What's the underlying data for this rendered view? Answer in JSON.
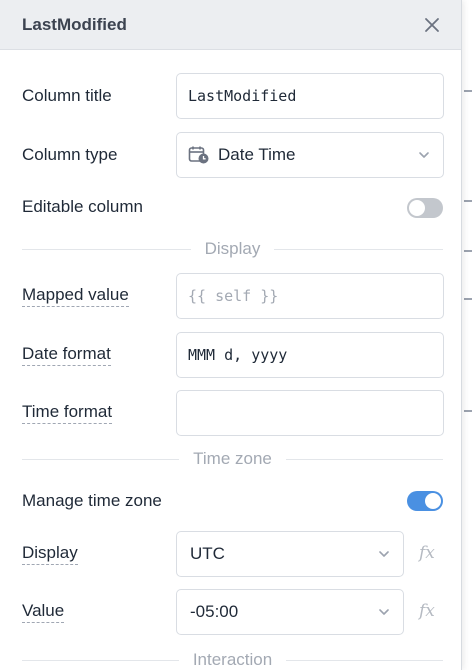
{
  "panel": {
    "title": "LastModified"
  },
  "fields": {
    "column_title": {
      "label": "Column title",
      "value": "LastModified"
    },
    "column_type": {
      "label": "Column type",
      "value": "Date Time",
      "icon": "calendar-clock-icon"
    },
    "editable_column": {
      "label": "Editable column",
      "enabled": false
    }
  },
  "sections": {
    "display": "Display",
    "time_zone": "Time zone",
    "interaction": "Interaction"
  },
  "display": {
    "mapped_value": {
      "label": "Mapped value",
      "placeholder": "{{ self }}",
      "value": ""
    },
    "date_format": {
      "label": "Date format",
      "value": "MMM d, yyyy"
    },
    "time_format": {
      "label": "Time format",
      "value": ""
    }
  },
  "time_zone": {
    "manage": {
      "label": "Manage time zone",
      "enabled": true
    },
    "display": {
      "label": "Display",
      "value": "UTC",
      "fx": "fx"
    },
    "value": {
      "label": "Value",
      "value": "-05:00",
      "fx": "fx"
    }
  },
  "colors": {
    "accent": "#4a90e2",
    "toggle_off": "#c3c7cd",
    "header_bg": "#eceef1"
  }
}
